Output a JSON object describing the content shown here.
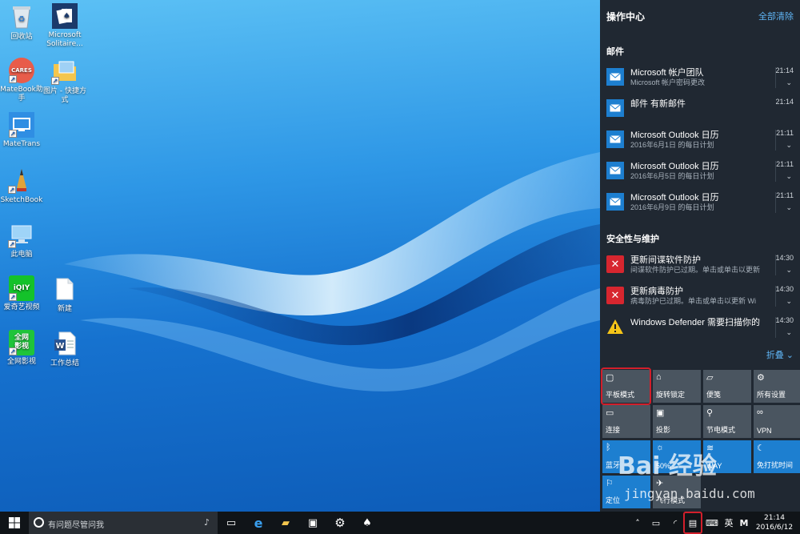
{
  "desktop": {
    "icons": [
      {
        "label": "回收站",
        "name": "recycle-bin"
      },
      {
        "label": "Microsoft Solitaire...",
        "name": "solitaire"
      },
      {
        "label": "MateBook助手",
        "name": "matebook-helper"
      },
      {
        "label": "图片 - 快捷方式",
        "name": "pictures-shortcut"
      },
      {
        "label": "MateTrans",
        "name": "matetrans"
      },
      {
        "label": "SketchBook",
        "name": "sketchbook"
      },
      {
        "label": "此电脑",
        "name": "this-pc"
      },
      {
        "label": "爱奇艺视频",
        "name": "iqiyi"
      },
      {
        "label": "新建",
        "name": "new-file"
      },
      {
        "label": "全网影视",
        "name": "quanwang-video"
      },
      {
        "label": "工作总结",
        "name": "work-summary"
      }
    ],
    "iqiyi_text": "iQIY",
    "quanwang_text": "全网影视",
    "cares_text": "CARES"
  },
  "action_center": {
    "title": "操作中心",
    "clear_all": "全部清除",
    "collapse": "折叠",
    "groups": [
      {
        "title": "邮件",
        "items": [
          {
            "title": "Microsoft 帐户团队",
            "body": "Microsoft 帐户密码更改",
            "time": "21:14",
            "chev": true
          },
          {
            "title": "邮件 有新邮件",
            "body": "",
            "time": "21:14",
            "chev": false
          },
          {
            "title": "Microsoft Outlook 日历",
            "body": "2016年6月1日 的每日计划",
            "time": "21:11",
            "chev": true
          },
          {
            "title": "Microsoft Outlook 日历",
            "body": "2016年6月5日 的每日计划",
            "time": "21:11",
            "chev": true
          },
          {
            "title": "Microsoft Outlook 日历",
            "body": "2016年6月9日 的每日计划",
            "time": "21:11",
            "chev": true
          }
        ]
      },
      {
        "title": "安全性与维护",
        "items": [
          {
            "title": "更新间谍软件防护",
            "body": "间谍软件防护已过期。单击或单击以更新",
            "time": "14:30",
            "chev": true,
            "kind": "error"
          },
          {
            "title": "更新病毒防护",
            "body": "病毒防护已过期。单击或单击以更新 Wi",
            "time": "14:30",
            "chev": true,
            "kind": "error"
          },
          {
            "title": "Windows Defender 需要扫描你的",
            "body": "",
            "time": "14:30",
            "chev": true,
            "kind": "warning"
          }
        ]
      }
    ],
    "quick_actions": [
      {
        "label": "平板模式",
        "icon": "tablet-mode-icon",
        "glyph": "▢",
        "on": false
      },
      {
        "label": "旋转锁定",
        "icon": "rotation-lock-icon",
        "glyph": "⌂",
        "on": false
      },
      {
        "label": "便笺",
        "icon": "note-icon",
        "glyph": "▱",
        "on": false
      },
      {
        "label": "所有设置",
        "icon": "gear-icon",
        "glyph": "⚙",
        "on": false
      },
      {
        "label": "连接",
        "icon": "connect-icon",
        "glyph": "▭",
        "on": false
      },
      {
        "label": "投影",
        "icon": "project-icon",
        "glyph": "▣",
        "on": false
      },
      {
        "label": "节电模式",
        "icon": "battery-saver-icon",
        "glyph": "⚲",
        "on": false
      },
      {
        "label": "VPN",
        "icon": "vpn-icon",
        "glyph": "∞",
        "on": false
      },
      {
        "label": "蓝牙",
        "icon": "bluetooth-icon",
        "glyph": "ᛒ",
        "on": true
      },
      {
        "label": "50%",
        "icon": "brightness-icon",
        "glyph": "☼",
        "on": true
      },
      {
        "label": "WAY",
        "icon": "wifi-icon",
        "glyph": "≋",
        "on": true
      },
      {
        "label": "免打扰时间",
        "icon": "quiet-hours-icon",
        "glyph": "☾",
        "on": true
      },
      {
        "label": "定位",
        "icon": "location-icon",
        "glyph": "⚐",
        "on": true
      },
      {
        "label": "飞行模式",
        "icon": "airplane-icon",
        "glyph": "✈",
        "on": false
      }
    ]
  },
  "taskbar": {
    "search_placeholder": "有问题尽管问我",
    "ime_label": "英",
    "ime_mode": "M",
    "time": "21:14",
    "date": "2016/6/12"
  },
  "watermark": {
    "brand": "Bai 经验",
    "url": "jingyan.baidu.com"
  },
  "colors": {
    "accent": "#1d7fd0",
    "highlight": "#d21f2b",
    "action_center_bg": "#202832",
    "taskbar_bg": "#101418"
  }
}
